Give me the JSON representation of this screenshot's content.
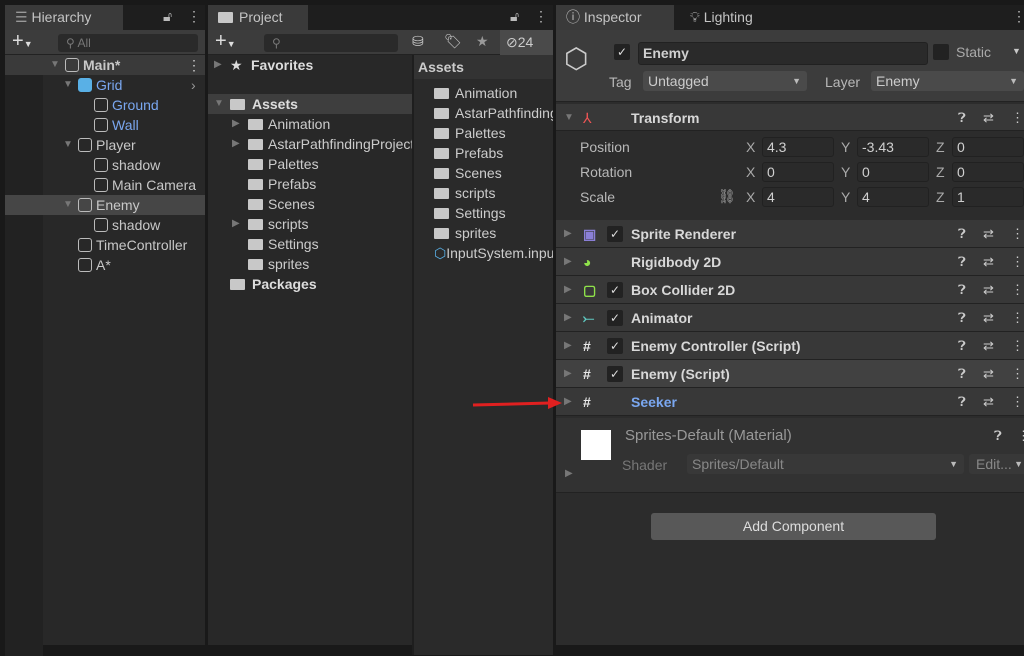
{
  "hierarchy": {
    "tab": "Hierarchy",
    "search_placeholder": "All",
    "items": [
      {
        "label": "Main*",
        "depth": 0,
        "expand": "down",
        "icon": "unity-scene-icon",
        "selected": true,
        "blue": false
      },
      {
        "label": "Grid",
        "depth": 1,
        "expand": "down",
        "icon": "prefab-cube-icon",
        "blue": true,
        "chevron": true
      },
      {
        "label": "Ground",
        "depth": 2,
        "icon": "gameobject-cube-icon",
        "blue": true
      },
      {
        "label": "Wall",
        "depth": 2,
        "icon": "gameobject-cube-icon",
        "blue": true
      },
      {
        "label": "Player",
        "depth": 1,
        "expand": "down",
        "icon": "gameobject-cube-icon"
      },
      {
        "label": "shadow",
        "depth": 2,
        "icon": "gameobject-cube-icon"
      },
      {
        "label": "Main Camera",
        "depth": 2,
        "icon": "gameobject-cube-icon"
      },
      {
        "label": "Enemy",
        "depth": 1,
        "expand": "down",
        "icon": "gameobject-cube-icon",
        "highlight": true
      },
      {
        "label": "shadow",
        "depth": 2,
        "icon": "gameobject-cube-icon"
      },
      {
        "label": "TimeController",
        "depth": 1,
        "icon": "gameobject-cube-icon"
      },
      {
        "label": "A*",
        "depth": 1,
        "icon": "gameobject-cube-icon"
      }
    ]
  },
  "project": {
    "tab": "Project",
    "hidden_count": "24",
    "favorites": "Favorites",
    "assets": "Assets",
    "packages": "Packages",
    "tree": [
      {
        "label": "Animation",
        "expand": true
      },
      {
        "label": "AstarPathfindingProject",
        "expand": true
      },
      {
        "label": "Palettes"
      },
      {
        "label": "Prefabs"
      },
      {
        "label": "Scenes"
      },
      {
        "label": "scripts",
        "expand": true
      },
      {
        "label": "Settings"
      },
      {
        "label": "sprites"
      }
    ],
    "grid_header": "Assets",
    "grid": [
      {
        "label": "Animation"
      },
      {
        "label": "AstarPathfindingProject"
      },
      {
        "label": "Palettes"
      },
      {
        "label": "Prefabs"
      },
      {
        "label": "Scenes"
      },
      {
        "label": "scripts"
      },
      {
        "label": "Settings"
      },
      {
        "label": "sprites"
      },
      {
        "label": "InputSystem.inputsettings",
        "icon": "input-asset-icon"
      }
    ]
  },
  "inspector": {
    "tab": "Inspector",
    "tab2": "Lighting",
    "name": "Enemy",
    "active": true,
    "static_label": "Static",
    "tag_label": "Tag",
    "tag": "Untagged",
    "layer_label": "Layer",
    "layer": "Enemy",
    "transform": {
      "title": "Transform",
      "rows": [
        {
          "label": "Position",
          "x": "4.3",
          "y": "-3.43",
          "z": "0"
        },
        {
          "label": "Rotation",
          "x": "0",
          "y": "0",
          "z": "0"
        },
        {
          "label": "Scale",
          "x": "4",
          "y": "4",
          "z": "1"
        }
      ]
    },
    "components": [
      {
        "name": "Sprite Renderer",
        "checked": true,
        "icon": "sprite-renderer-icon",
        "color": "#8a7fd6"
      },
      {
        "name": "Rigidbody 2D",
        "checked": null,
        "icon": "rigidbody2d-icon",
        "color": "#8fe24a"
      },
      {
        "name": "Box Collider 2D",
        "checked": true,
        "icon": "box-collider-icon",
        "color": "#8fe24a"
      },
      {
        "name": "Animator",
        "checked": true,
        "icon": "animator-icon",
        "color": "#5fc8c0"
      },
      {
        "name": "Enemy Controller (Script)",
        "checked": true,
        "icon": "script-icon",
        "color": "#e8e8e8"
      },
      {
        "name": "Enemy (Script)",
        "checked": true,
        "icon": "script-icon",
        "color": "#e8e8e8"
      },
      {
        "name": "Seeker",
        "checked": null,
        "icon": "script-icon",
        "color": "#e8e8e8",
        "blue": true
      }
    ],
    "material": {
      "name": "Sprites-Default (Material)",
      "shader_label": "Shader",
      "shader": "Sprites/Default",
      "edit": "Edit..."
    },
    "add_component": "Add Component"
  },
  "colors": {
    "selection_blue": "#7aa7f0",
    "annotation_arrow": "#e02020"
  }
}
